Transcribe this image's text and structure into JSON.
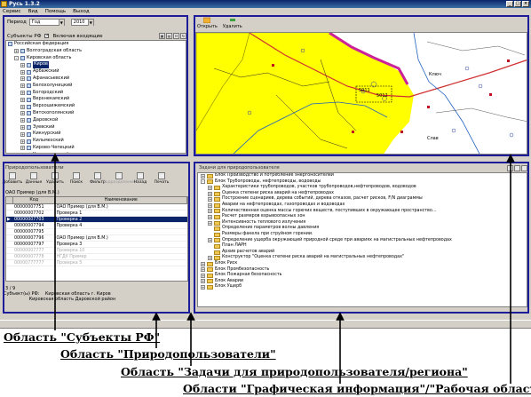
{
  "window": {
    "title": "Русь 1.3.2"
  },
  "menu": [
    "Сервис",
    "Вид",
    "Помощь",
    "Выход"
  ],
  "period": {
    "label": "Период",
    "type_value": "Год",
    "year_value": "2010"
  },
  "subjects": {
    "label": "Субъекты РФ",
    "include_nested_label": "Включая входящие",
    "tree": [
      {
        "label": "Российская федерация",
        "level": 0,
        "exp": ""
      },
      {
        "label": "Волгоградская область",
        "level": 1,
        "exp": "+"
      },
      {
        "label": "Кировская область",
        "level": 1,
        "exp": "-"
      },
      {
        "label": "Киров",
        "level": 2,
        "exp": "+",
        "selected": true
      },
      {
        "label": "Арбажский",
        "level": 2,
        "exp": "+"
      },
      {
        "label": "Афанасьевский",
        "level": 2,
        "exp": "+"
      },
      {
        "label": "Белохолуницкий",
        "level": 2,
        "exp": "+"
      },
      {
        "label": "Богородский",
        "level": 2,
        "exp": "+"
      },
      {
        "label": "Верхнекамский",
        "level": 2,
        "exp": "+"
      },
      {
        "label": "Верхошижемский",
        "level": 2,
        "exp": "+"
      },
      {
        "label": "Вятскополянский",
        "level": 2,
        "exp": "+"
      },
      {
        "label": "Даровской",
        "level": 2,
        "exp": "+"
      },
      {
        "label": "Зуевский",
        "level": 2,
        "exp": "+"
      },
      {
        "label": "Кикнурский",
        "level": 2,
        "exp": "+"
      },
      {
        "label": "Кильмезский",
        "level": 2,
        "exp": "+"
      },
      {
        "label": "Кирово-Чепецкий",
        "level": 2,
        "exp": "+"
      },
      {
        "label": "Котельничский",
        "level": 2,
        "exp": "+"
      }
    ]
  },
  "users": {
    "header": "Природопользователи",
    "toolbar": [
      {
        "label": "Добавить",
        "disabled": false
      },
      {
        "label": "Данные",
        "disabled": false
      },
      {
        "label": "Удалить",
        "disabled": false
      },
      {
        "label": "Поиск",
        "disabled": false
      },
      {
        "label": "Фильтр",
        "disabled": false
      },
      {
        "label": "Подразделения",
        "disabled": true
      },
      {
        "label": "Назад",
        "disabled": false
      },
      {
        "label": "Печать",
        "disabled": false
      }
    ],
    "filter_text": "ОАО Пример (для В.М.)",
    "columns": [
      "Код",
      "Наименование"
    ],
    "rows": [
      {
        "code": "00000007751",
        "name": "ОАО Пример (для В.М.)",
        "faded": false
      },
      {
        "code": "00000007702",
        "name": "Проверка 1",
        "faded": false
      },
      {
        "code": "00000007703",
        "name": "Проверка 2",
        "selected": true,
        "faded": false
      },
      {
        "code": "00000007794",
        "name": "Проверка 4",
        "faded": false
      },
      {
        "code": "00000007795",
        "name": "",
        "faded": false
      },
      {
        "code": "00000007796",
        "name": "ОАО Пример (для В.М.)",
        "faded": false
      },
      {
        "code": "00000007797",
        "name": "Проверка 3",
        "faded": false
      },
      {
        "code": "00000007777",
        "name": "Проверка 10",
        "faded": true
      },
      {
        "code": "00000007778",
        "name": "НГДУ Пример",
        "faded": true
      },
      {
        "code": "00000777777",
        "name": "Проверка 5",
        "faded": true
      }
    ],
    "count": "3 / 9",
    "status_lines": [
      "Субъект(ы) РФ:    Кировская область г. Киров",
      "                  Кировская область Даровской район"
    ]
  },
  "map": {
    "toolbar": [
      {
        "label": "Открыть"
      },
      {
        "label": "Удалить"
      }
    ],
    "labels": [
      "5011",
      "5012",
      "Ключ",
      "Слав"
    ]
  },
  "tasks": {
    "header": "Задачи для природопользователя",
    "tree": [
      {
        "label": "Блок Производство и потребление энергоносителей",
        "level": 0,
        "exp": "+"
      },
      {
        "label": "Блок Трубопроводы, нефтепроводы, водоводы",
        "level": 0,
        "exp": "-"
      },
      {
        "label": "Характеристики трубопроводов, участков трубопроводов,нефтепроводов, водоводов",
        "level": 1,
        "exp": "+"
      },
      {
        "label": "Оценка степени риска аварий на нефтепроводах",
        "level": 1,
        "exp": "+"
      },
      {
        "label": "Построение сценариев, дерева событий, дерева отказов, расчет рисков, F/N диаграммы",
        "level": 1,
        "exp": "+"
      },
      {
        "label": "Аварии на нефтепроводах, газопроводах и водоводах",
        "level": 1,
        "exp": "+"
      },
      {
        "label": "Количественная оценка массы горючих веществ, поступивших в окружающее пространство...",
        "level": 1,
        "exp": "+"
      },
      {
        "label": "Расчет размеров взрывоопасных зон",
        "level": 1,
        "exp": "+"
      },
      {
        "label": "Интенсивность теплового излучения",
        "level": 1,
        "exp": "+"
      },
      {
        "label": "Определение параметров волны давления",
        "level": 1,
        "exp": ""
      },
      {
        "label": "Размеры факела при струйном горении.",
        "level": 1,
        "exp": ""
      },
      {
        "label": "Определение ущерба окружающей природной среде при авариях на магистральных нефтепроводах",
        "level": 1,
        "exp": "+"
      },
      {
        "label": "План ЛАРН",
        "level": 1,
        "exp": ""
      },
      {
        "label": "Архив расчетов аварий",
        "level": 1,
        "exp": ""
      },
      {
        "label": "Конструктор \"Оценка степени риска аварий на магистральных  нефтепроводах\"",
        "level": 1,
        "exp": "+"
      },
      {
        "label": "Блок Риск",
        "level": 0,
        "exp": "+"
      },
      {
        "label": "Блок Промбезопасность",
        "level": 0,
        "exp": "+"
      },
      {
        "label": "Блок Пожарная безопасность",
        "level": 0,
        "exp": "+"
      },
      {
        "label": "Блок Аварии",
        "level": 0,
        "exp": "+"
      },
      {
        "label": "Блок Ущерб",
        "level": 0,
        "exp": "+"
      }
    ]
  },
  "captions": {
    "c1": "Область \"Субъекты РФ\"",
    "c2": "Область \"Природопользователи\"",
    "c3": "Область \"Задачи для природопользователя/региона\"",
    "c4": "Области \"Графическая информация\"/\"Рабочая область\""
  },
  "colors": {
    "frame": "#1d1d9a",
    "map_yellow": "#ffff00",
    "map_magenta": "#cc2299",
    "map_road": "#d03030"
  }
}
